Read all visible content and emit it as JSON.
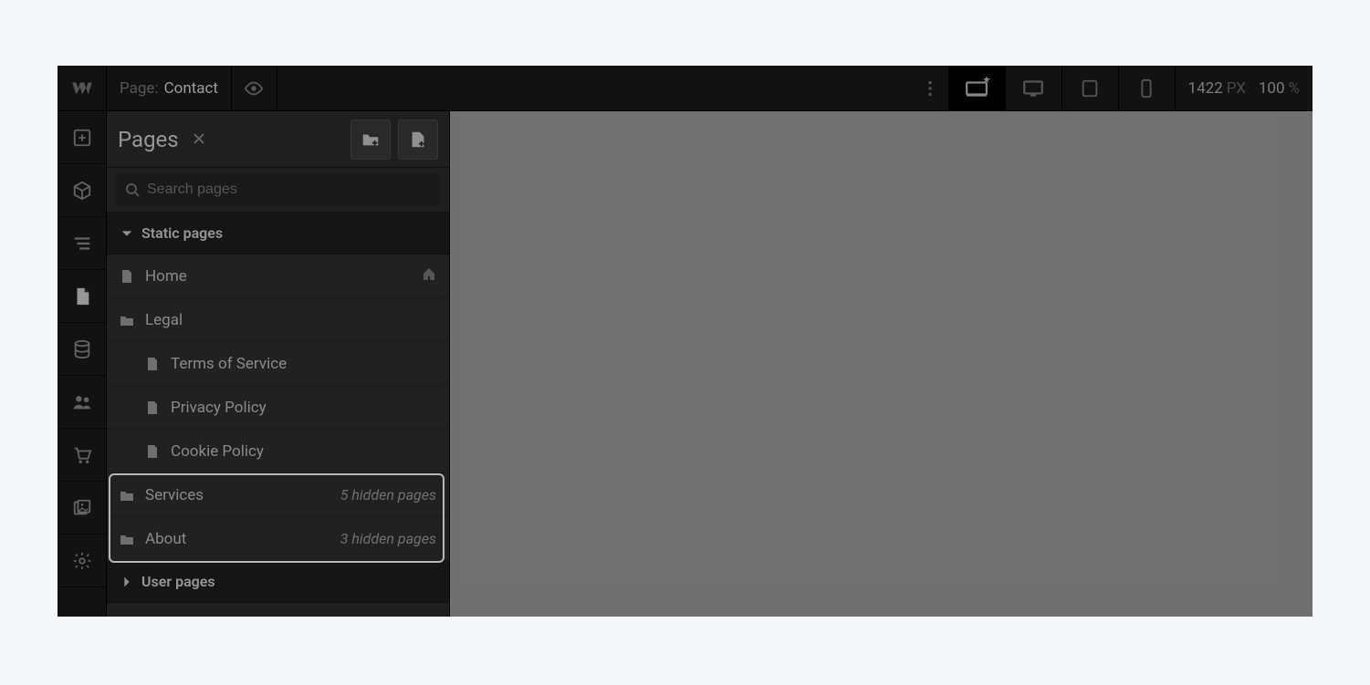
{
  "topbar": {
    "page_prefix": "Page:",
    "current_page": "Contact"
  },
  "viewport": {
    "width": "1422",
    "width_unit": "PX",
    "zoom": "100",
    "zoom_unit": "%"
  },
  "panel": {
    "title": "Pages",
    "search_placeholder": "Search pages"
  },
  "sections": {
    "static": "Static pages",
    "user": "User pages"
  },
  "pages": {
    "home": "Home",
    "legal": "Legal",
    "tos": "Terms of Service",
    "privacy": "Privacy Policy",
    "cookie": "Cookie Policy",
    "services": "Services",
    "services_hidden": "5 hidden pages",
    "about": "About",
    "about_hidden": "3 hidden pages"
  },
  "icons": {
    "logo": "webflow-logo",
    "preview": "eye-icon",
    "more": "more-vertical-icon",
    "desktop": "desktop-icon",
    "laptop": "laptop-icon",
    "tablet": "tablet-icon",
    "phone": "phone-icon",
    "add": "plus-icon",
    "components": "box-icon",
    "navigator": "navigator-icon",
    "pages": "page-icon",
    "cms": "database-icon",
    "users": "users-icon",
    "ecommerce": "cart-icon",
    "assets": "image-icon",
    "settings": "gear-icon",
    "new_folder": "new-folder-icon",
    "new_page": "new-page-icon",
    "search": "search-icon",
    "page_doc": "page-icon",
    "folder": "folder-icon",
    "home_badge": "home-icon"
  }
}
